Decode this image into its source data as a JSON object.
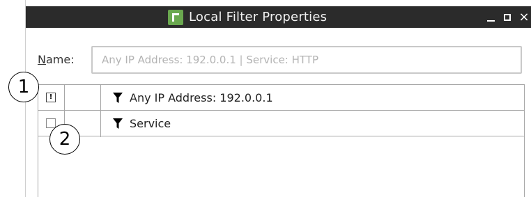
{
  "window": {
    "title": "Local Filter Properties",
    "controls": {
      "minimize": "minimize-icon",
      "maximize": "maximize-icon",
      "close": "×"
    }
  },
  "form": {
    "name_label_prefix": "N",
    "name_label_rest": "ame:",
    "name_placeholder": "Any IP Address: 192.0.0.1 | Service: HTTP",
    "name_value": ""
  },
  "filters": [
    {
      "check_glyph": "!",
      "icon": "funnel-icon",
      "label": "Any IP Address: 192.0.0.1"
    },
    {
      "check_glyph": "",
      "icon": "funnel-icon",
      "label": "Service"
    }
  ],
  "callouts": [
    "1",
    "2"
  ],
  "colors": {
    "title_bar": "#2b2b2b",
    "app_icon": "#6aa84f",
    "table_border": "#a6a6a6"
  }
}
